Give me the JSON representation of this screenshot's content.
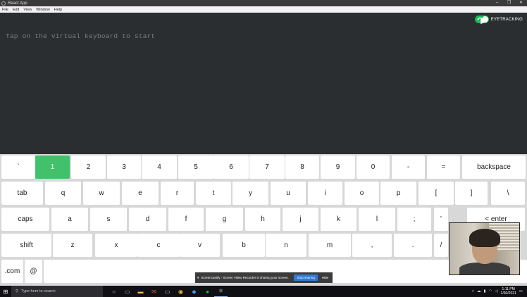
{
  "window": {
    "title": "React App",
    "controls": [
      "–",
      "❐",
      "✕"
    ]
  },
  "menu": [
    "File",
    "Edit",
    "View",
    "Window",
    "Help"
  ],
  "editor": {
    "placeholder": "Tap on the virtual keyboard to start"
  },
  "eyetracking": {
    "label": "EYETRACKING",
    "enabled": true,
    "color": "#1db954"
  },
  "keyboard": {
    "active_key": "1",
    "active_color": "#41c26a",
    "rows": [
      [
        "`",
        "1",
        "2",
        "3",
        "4",
        "5",
        "6",
        "7",
        "8",
        "9",
        "0",
        "-",
        "=",
        "backspace"
      ],
      [
        "tab",
        "q",
        "w",
        "e",
        "r",
        "t",
        "y",
        "u",
        "i",
        "o",
        "p",
        "[",
        "]",
        "\\"
      ],
      [
        "caps",
        "a",
        "s",
        "d",
        "f",
        "g",
        "h",
        "j",
        "k",
        "l",
        ";",
        "'",
        "< enter"
      ],
      [
        "shift",
        "z",
        "x",
        "c",
        "v",
        "b",
        "n",
        "m",
        ",",
        ".",
        "/"
      ],
      [
        ".com",
        "@",
        ""
      ]
    ]
  },
  "screen_share": {
    "message": "Screencastify - Screen Video Recorder is sharing your screen.",
    "stop_label": "Stop sharing",
    "hide_label": "Hide"
  },
  "taskbar": {
    "search_placeholder": "Type here to search",
    "apps": [
      "cortana-icon",
      "task-view-icon",
      "file-explorer-icon",
      "mail-icon",
      "terminal-icon",
      "chrome-icon",
      "vscode-icon",
      "spotify-icon",
      "electron-app-icon"
    ],
    "time": "1:11 PM",
    "date": "1/30/2021"
  }
}
